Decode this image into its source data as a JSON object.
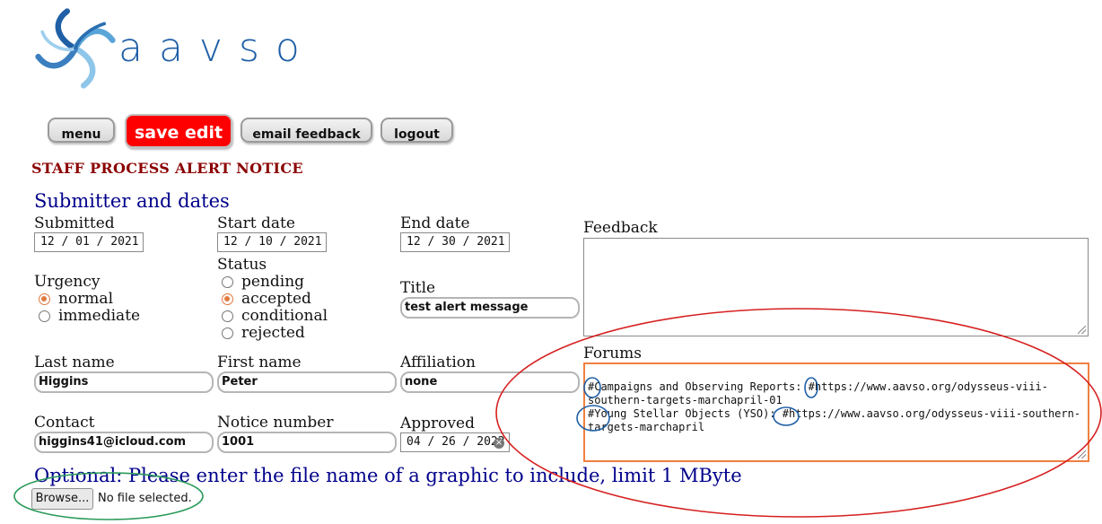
{
  "logo": {
    "text": "aavso"
  },
  "nav": {
    "menu": "menu",
    "save_edit": "save edit",
    "email_feedback": "email feedback",
    "logout": "logout"
  },
  "page_heading": "STAFF PROCESS ALERT NOTICE",
  "section_heading": "Submitter and dates",
  "fields": {
    "submitted": {
      "label": "Submitted",
      "value": "12 / 01 / 2021"
    },
    "start_date": {
      "label": "Start date",
      "value": "12 / 10 / 2021"
    },
    "end_date": {
      "label": "End date",
      "value": "12 / 30 / 2021"
    },
    "urgency": {
      "label": "Urgency",
      "options": [
        "normal",
        "immediate"
      ],
      "selected": "normal"
    },
    "status": {
      "label": "Status",
      "options": [
        "pending",
        "accepted",
        "conditional",
        "rejected"
      ],
      "selected": "accepted"
    },
    "title": {
      "label": "Title",
      "value": "test alert message"
    },
    "last_name": {
      "label": "Last name",
      "value": "Higgins"
    },
    "first_name": {
      "label": "First name",
      "value": "Peter"
    },
    "affiliation": {
      "label": "Affiliation",
      "value": "none"
    },
    "contact": {
      "label": "Contact",
      "value": "higgins41@icloud.com"
    },
    "notice_number": {
      "label": "Notice number",
      "value": "1001"
    },
    "approved": {
      "label": "Approved",
      "value": "04 / 26 / 2022"
    },
    "feedback": {
      "label": "Feedback",
      "value": ""
    },
    "forums": {
      "label": "Forums",
      "value": "#Campaigns and Observing Reports: #https://www.aavso.org/odysseus-viii-southern-targets-marchapril-01\n#Young Stellar Objects (YSO): #https://www.aavso.org/odysseus-viii-southern-targets-marchapril"
    }
  },
  "upload": {
    "prompt": "Optional: Please enter the file name of a graphic to include, limit 1 MByte",
    "button": "Browse...",
    "status": "No file selected."
  },
  "colors": {
    "save_button": "#ff0000",
    "heading_red": "#8b0000",
    "heading_blue": "#00008b",
    "annotation_red": "#d62020",
    "annotation_green": "#2a9a5a",
    "annotation_blue": "#1f5fa6"
  }
}
